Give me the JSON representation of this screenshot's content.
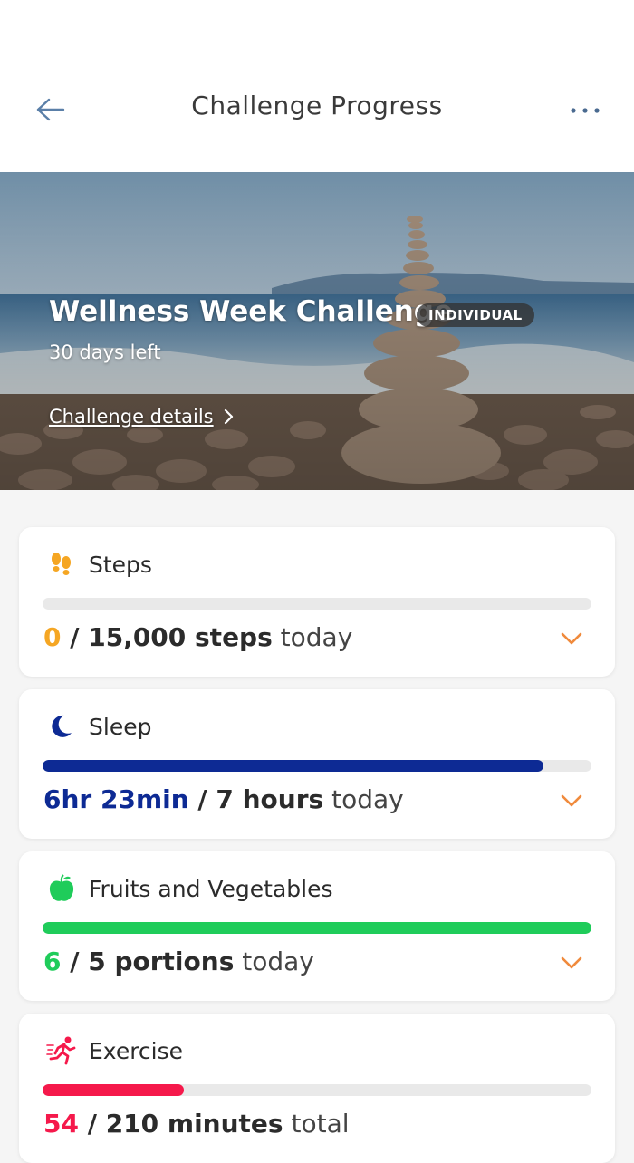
{
  "header": {
    "title": "Challenge Progress"
  },
  "hero": {
    "challenge_name": "Wellness Week Challenge",
    "badge": "INDIVIDUAL",
    "days_left": "30 days left",
    "details_link": "Challenge details"
  },
  "metrics": [
    {
      "label": "Steps",
      "icon": "footsteps-icon",
      "current": "0",
      "separator": " / ",
      "goal": "15,000 steps",
      "suffix": " today",
      "progress": 0,
      "color": "#f5a623"
    },
    {
      "label": "Sleep",
      "icon": "moon-icon",
      "current": "6hr 23min",
      "separator": " / ",
      "goal": "7 hours",
      "suffix": " today",
      "progress": 0.912,
      "color": "#0d2a94"
    },
    {
      "label": "Fruits and Vegetables",
      "icon": "apple-icon",
      "current": "6",
      "separator": " / ",
      "goal": "5 portions",
      "suffix": " today",
      "progress": 1.0,
      "color": "#1fcc5a"
    },
    {
      "label": "Exercise",
      "icon": "running-icon",
      "current": "54",
      "separator": " / ",
      "goal": "210 minutes",
      "suffix": " total",
      "progress": 0.257,
      "color": "#f5194b"
    }
  ],
  "colors": {
    "accent_orange": "#f08a3c",
    "back_arrow": "#5a7fa8"
  }
}
